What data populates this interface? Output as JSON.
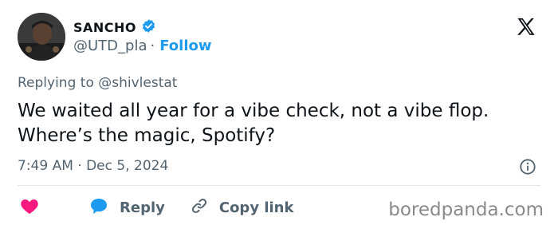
{
  "author": {
    "name": "SANCHO",
    "handle": "@UTD_pla",
    "separator": "·",
    "follow_label": "Follow"
  },
  "reply_context": "Replying to @shivlestat",
  "tweet": {
    "text": "We waited all year for a vibe check, not a vibe flop. Where’s the magic, Spotify?",
    "time": "7:49 AM · Dec 5, 2024"
  },
  "actions": {
    "reply_label": "Reply",
    "copy_link_label": "Copy link"
  },
  "watermark": "boredpanda.com",
  "colors": {
    "accent": "#1d9bf0",
    "like": "#f91880",
    "muted": "#536471",
    "text": "#0f1419"
  },
  "icons": [
    "verified-badge-icon",
    "x-logo-icon",
    "info-icon",
    "heart-icon",
    "reply-bubble-icon",
    "link-icon"
  ]
}
